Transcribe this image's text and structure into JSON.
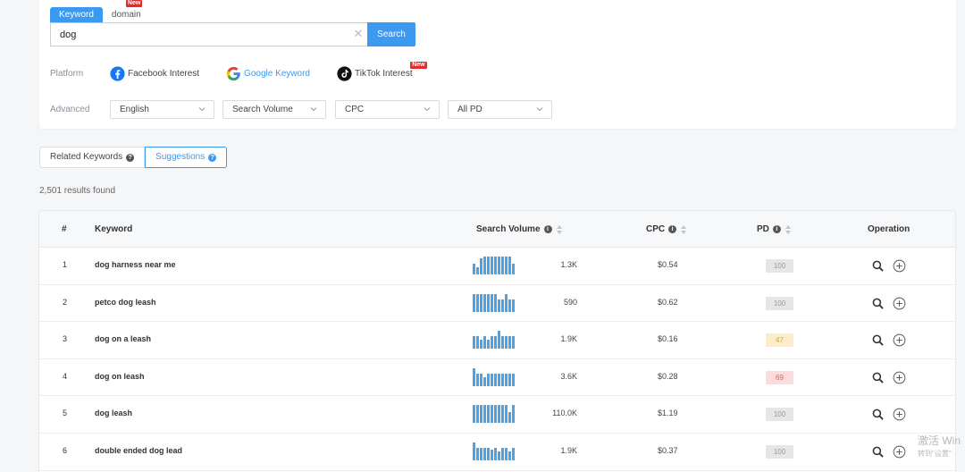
{
  "search": {
    "tabs": [
      {
        "label": "Keyword",
        "active": true
      },
      {
        "label": "domain",
        "active": false,
        "badge": "New"
      }
    ],
    "query": "dog",
    "button_label": "Search"
  },
  "platform": {
    "label": "Platform",
    "items": [
      {
        "label": "Facebook Interest",
        "icon": "facebook-icon"
      },
      {
        "label": "Google Keyword",
        "icon": "google-icon",
        "active": true
      },
      {
        "label": "TikTok Interest",
        "icon": "tiktok-icon",
        "badge": "New"
      }
    ]
  },
  "advanced": {
    "label": "Advanced",
    "filters": [
      "English",
      "Search Volume",
      "CPC",
      "All PD"
    ]
  },
  "result_tabs": [
    {
      "label": "Related Keywords",
      "active": false
    },
    {
      "label": "Suggestions",
      "active": true
    }
  ],
  "results_count": "2,501 results found",
  "table": {
    "headers": {
      "num": "#",
      "keyword": "Keyword",
      "volume": "Search Volume",
      "cpc": "CPC",
      "pd": "PD",
      "operation": "Operation"
    },
    "rows": [
      {
        "num": "1",
        "keyword": "dog harness near me",
        "volume": "1.3K",
        "cpc": "$0.54",
        "pd": "100",
        "pd_level": "gray",
        "trend": [
          0.6,
          0.4,
          0.9,
          1,
          1,
          1,
          1,
          1,
          1,
          1,
          1,
          0.6
        ]
      },
      {
        "num": "2",
        "keyword": "petco dog leash",
        "volume": "590",
        "cpc": "$0.62",
        "pd": "100",
        "pd_level": "gray",
        "trend": [
          1,
          1,
          1,
          1,
          1,
          1,
          1,
          0.7,
          0.7,
          1,
          0.7,
          0.7
        ]
      },
      {
        "num": "3",
        "keyword": "dog on a leash",
        "volume": "1.9K",
        "cpc": "$0.16",
        "pd": "47",
        "pd_level": "yellow",
        "trend": [
          0.7,
          0.7,
          0.5,
          0.7,
          0.5,
          0.7,
          0.7,
          1,
          0.7,
          0.7,
          0.7,
          0.7
        ]
      },
      {
        "num": "4",
        "keyword": "dog on leash",
        "volume": "3.6K",
        "cpc": "$0.28",
        "pd": "69",
        "pd_level": "red",
        "trend": [
          1,
          0.7,
          0.7,
          0.5,
          0.7,
          0.7,
          0.7,
          0.7,
          0.7,
          0.7,
          0.7,
          0.7
        ]
      },
      {
        "num": "5",
        "keyword": "dog leash",
        "volume": "110.0K",
        "cpc": "$1.19",
        "pd": "100",
        "pd_level": "gray",
        "trend": [
          1,
          1,
          1,
          1,
          1,
          1,
          1,
          1,
          1,
          1,
          0.6,
          1
        ]
      },
      {
        "num": "6",
        "keyword": "double ended dog lead",
        "volume": "1.9K",
        "cpc": "$0.37",
        "pd": "100",
        "pd_level": "gray",
        "trend": [
          1,
          0.7,
          0.7,
          0.7,
          0.7,
          0.6,
          0.7,
          0.5,
          0.7,
          0.7,
          0.5,
          0.7
        ]
      }
    ]
  },
  "colors": {
    "accent": "#3b99f0",
    "bar": "#4aa3e8",
    "pd_gray": "#e6e6e6",
    "pd_yellow": "#fcecc9",
    "pd_red": "#fadcdc"
  },
  "watermark": {
    "line1": "激活 Win",
    "line2": "转到\"设置\""
  }
}
